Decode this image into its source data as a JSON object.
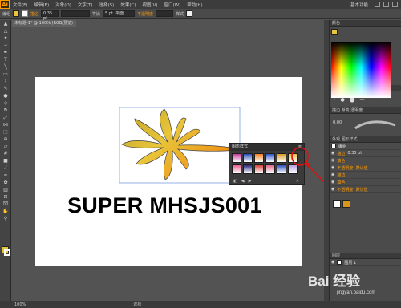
{
  "menubar": {
    "logo": "Ai",
    "items": [
      "文件(F)",
      "编辑(E)",
      "对象(O)",
      "文字(T)",
      "选择(S)",
      "效果(C)",
      "视图(V)",
      "窗口(W)",
      "帮助(H)"
    ],
    "workspace": "基本功能"
  },
  "control": {
    "group_label": "编组",
    "stroke_label": "描边",
    "stroke_value": "0.35 pt",
    "profile_label": "等比",
    "brush_value": "5 pt. 平面",
    "opacity_label": "不透明度",
    "style_label": "样式"
  },
  "doc_tab": "未标题-1* @ 100% (RGB/预览)",
  "headline": "SUPER MHSJS001",
  "graphic_styles": {
    "title": "图形样式",
    "swatches": [
      "#c83ca0",
      "#2a4fb8",
      "#f08020",
      "#2f56c8",
      "#d99a20",
      "#e8c040",
      "#e86090",
      "#2b2b80",
      "#d8403a",
      "#e06a8a",
      "#3050c0",
      "#b8a0e0"
    ]
  },
  "right_panel": {
    "color_tab": "颜色",
    "swatch_tabs": [
      "色板",
      "画笔",
      "符号"
    ],
    "stroke_tabs": [
      "描边",
      "渐变",
      "透明度"
    ],
    "stroke_value": "0.00",
    "appearance_tabs": [
      "外观",
      "图形样式"
    ],
    "appearance_rows": [
      "编组",
      "描边",
      "填色",
      "不透明度: 默认值",
      "描边",
      "填色",
      "不透明度: 默认值"
    ],
    "stroke_detail": "0.35 pt",
    "layers_tab": "图层",
    "layer_name": "图层 1"
  },
  "statusbar": {
    "zoom": "100%",
    "tool": "选择"
  },
  "watermark": {
    "brand": "Bai 经验",
    "url": "jingyan.baidu.com"
  }
}
